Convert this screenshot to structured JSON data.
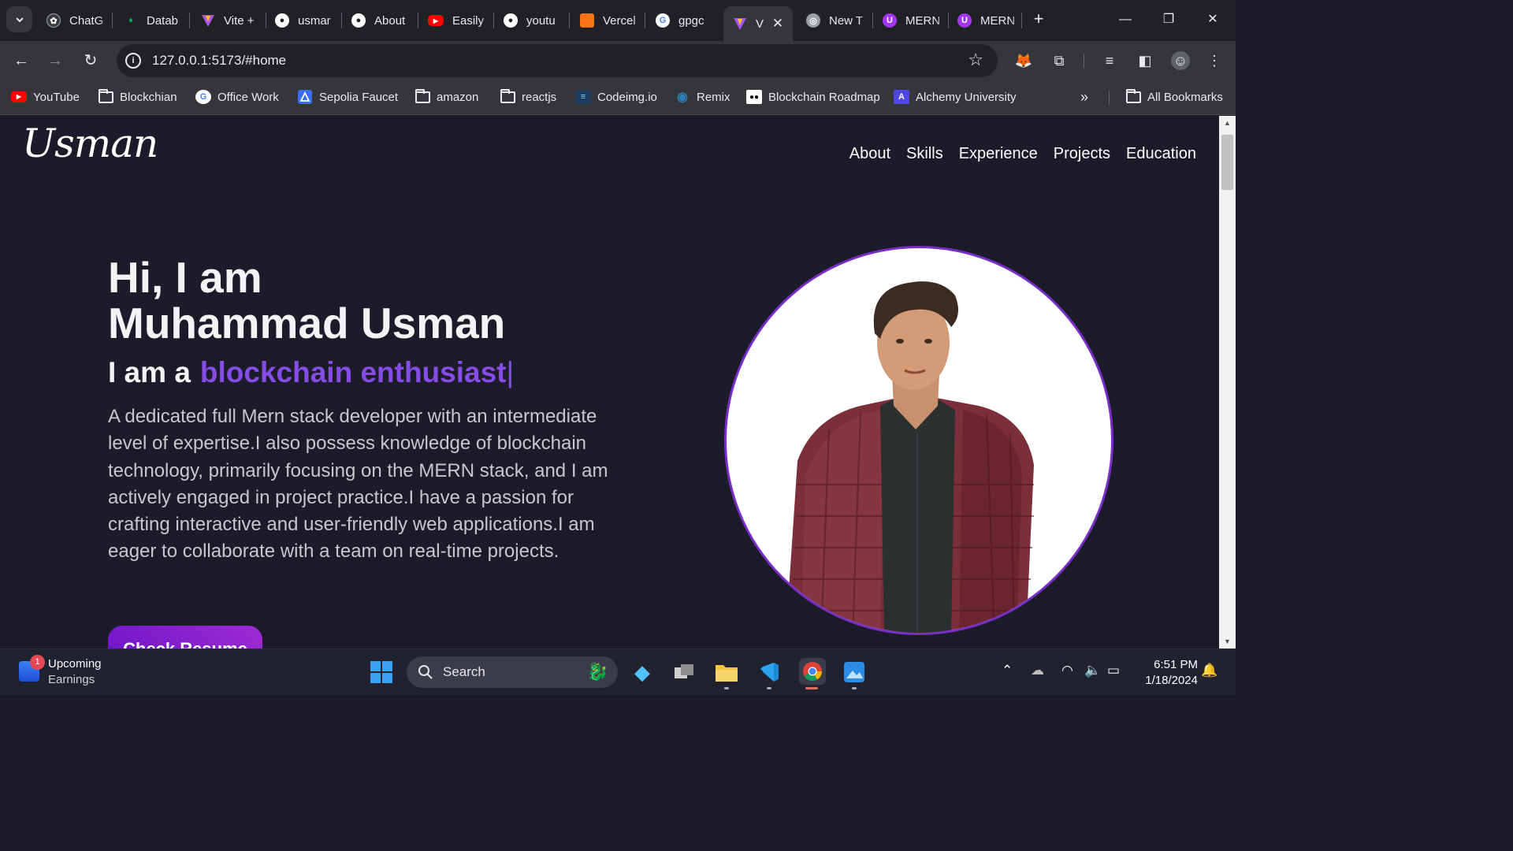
{
  "browser": {
    "tabs": [
      {
        "title": "ChatG",
        "icon": "chatgpt-icon",
        "color": "#6b6b6b"
      },
      {
        "title": "Datab",
        "icon": "mongodb-icon",
        "color": "#13aa52"
      },
      {
        "title": "Vite +",
        "icon": "vite-icon",
        "color": "#a855f7"
      },
      {
        "title": "usmar",
        "icon": "github-icon",
        "color": "#ffffff"
      },
      {
        "title": "About",
        "icon": "github-icon",
        "color": "#ffffff"
      },
      {
        "title": "Easily",
        "icon": "youtube-icon",
        "color": "#ff0000"
      },
      {
        "title": "youtu",
        "icon": "github-icon",
        "color": "#ffffff"
      },
      {
        "title": "Vercel",
        "icon": "vercel-icon",
        "color": "#f97316"
      },
      {
        "title": "gpgc",
        "icon": "google-icon",
        "color": "#4285f4"
      },
      {
        "title": "V",
        "icon": "vite-icon",
        "color": "#a855f7",
        "active": true
      },
      {
        "title": "New T",
        "icon": "chrome-icon",
        "color": "#9aa0a6"
      },
      {
        "title": "MERN",
        "icon": "udemy-icon",
        "color": "#a435f0"
      },
      {
        "title": "MERN",
        "icon": "udemy-icon",
        "color": "#a435f0"
      }
    ],
    "url": "127.0.0.1:5173/#home",
    "bookmarks": [
      {
        "label": "YouTube",
        "icon": "youtube-icon"
      },
      {
        "label": "Blockchian",
        "icon": "folder-icon"
      },
      {
        "label": "Office Work",
        "icon": "google-icon"
      },
      {
        "label": "Sepolia Faucet",
        "icon": "alchemy-icon"
      },
      {
        "label": "amazon",
        "icon": "folder-icon"
      },
      {
        "label": "reactjs",
        "icon": "folder-icon"
      },
      {
        "label": "Codeimg.io",
        "icon": "codeimg-icon"
      },
      {
        "label": "Remix",
        "icon": "remix-icon"
      },
      {
        "label": "Blockchain Roadmap",
        "icon": "medium-icon"
      },
      {
        "label": "Alchemy University",
        "icon": "alchemy-university-icon"
      }
    ],
    "more_bookmarks": "»",
    "all_bookmarks": "All Bookmarks"
  },
  "page": {
    "logo": "Usman",
    "nav": [
      "About",
      "Skills",
      "Experience",
      "Projects",
      "Education"
    ],
    "hero": {
      "greeting": "Hi, I am",
      "name": "Muhammad Usman",
      "role_prefix": "I am a",
      "role": "blockchain enthusiast",
      "caret": "|",
      "description": "A dedicated full Mern stack developer with an intermediate level of expertise.I also possess knowledge of blockchain technology, primarily focusing on the MERN stack, and I am actively engaged in project practice.I have a passion for crafting interactive and user-friendly web applications.I am eager to collaborate with a team on real-time projects.",
      "button": "Check Resume"
    },
    "accent": "#854ce6"
  },
  "taskbar": {
    "widget_title": "Upcoming",
    "widget_sub": "Earnings",
    "widget_badge": "1",
    "search": "Search",
    "time": "6:51 PM",
    "date": "1/18/2024"
  }
}
